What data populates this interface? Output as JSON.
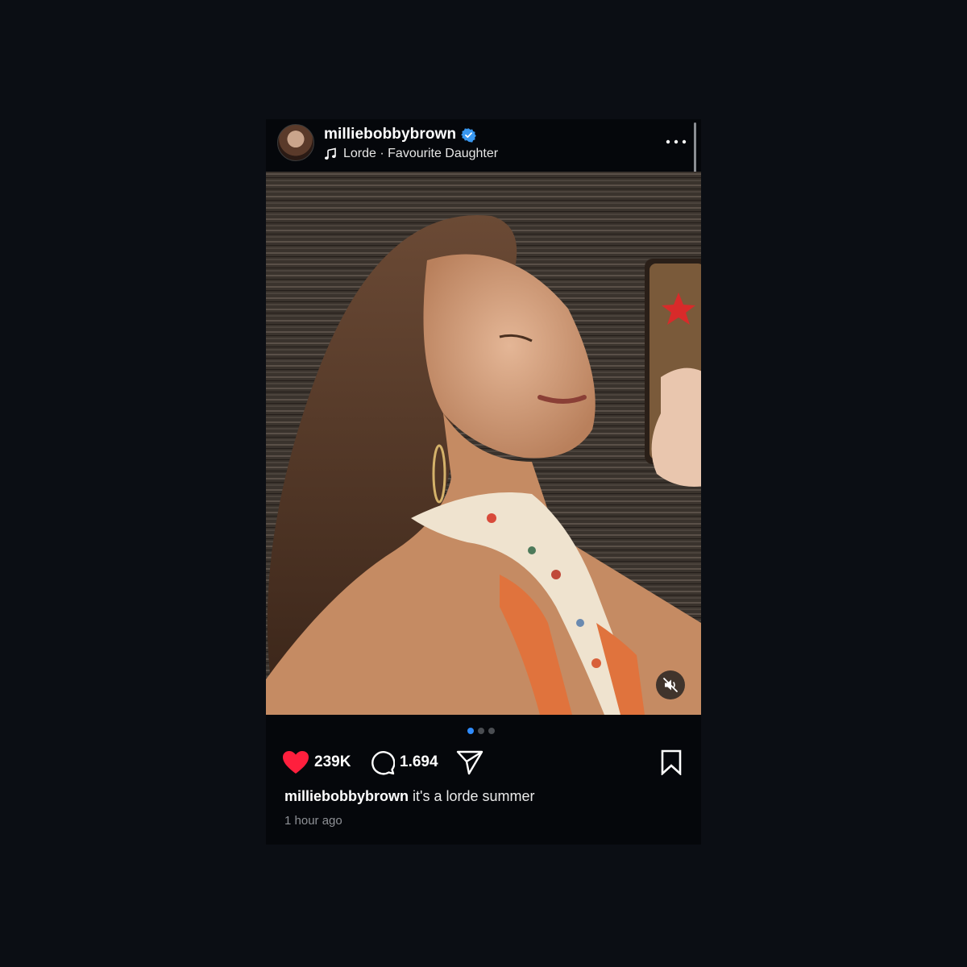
{
  "post": {
    "username": "milliebobbybrown",
    "verified": true,
    "audio": "Lorde · Favourite Daughter",
    "likes": "239K",
    "comments": "1.694",
    "caption_user": "milliebobbybrown",
    "caption_text": "it's a lorde summer",
    "time": "1 hour ago",
    "carousel": {
      "count": 3,
      "active_index": 0
    },
    "video_muted": true
  },
  "icons": {
    "verified": "verified-badge-icon",
    "music": "music-note-icon",
    "more": "more-horizontal-icon",
    "like": "heart-filled-icon",
    "comment": "comment-bubble-icon",
    "share": "paper-plane-icon",
    "save": "bookmark-icon",
    "mute": "speaker-muted-icon"
  },
  "colors": {
    "background": "#0b0e14",
    "like_red": "#ff1f3d",
    "verified_blue": "#3897f0",
    "active_dot": "#2f8cff"
  }
}
